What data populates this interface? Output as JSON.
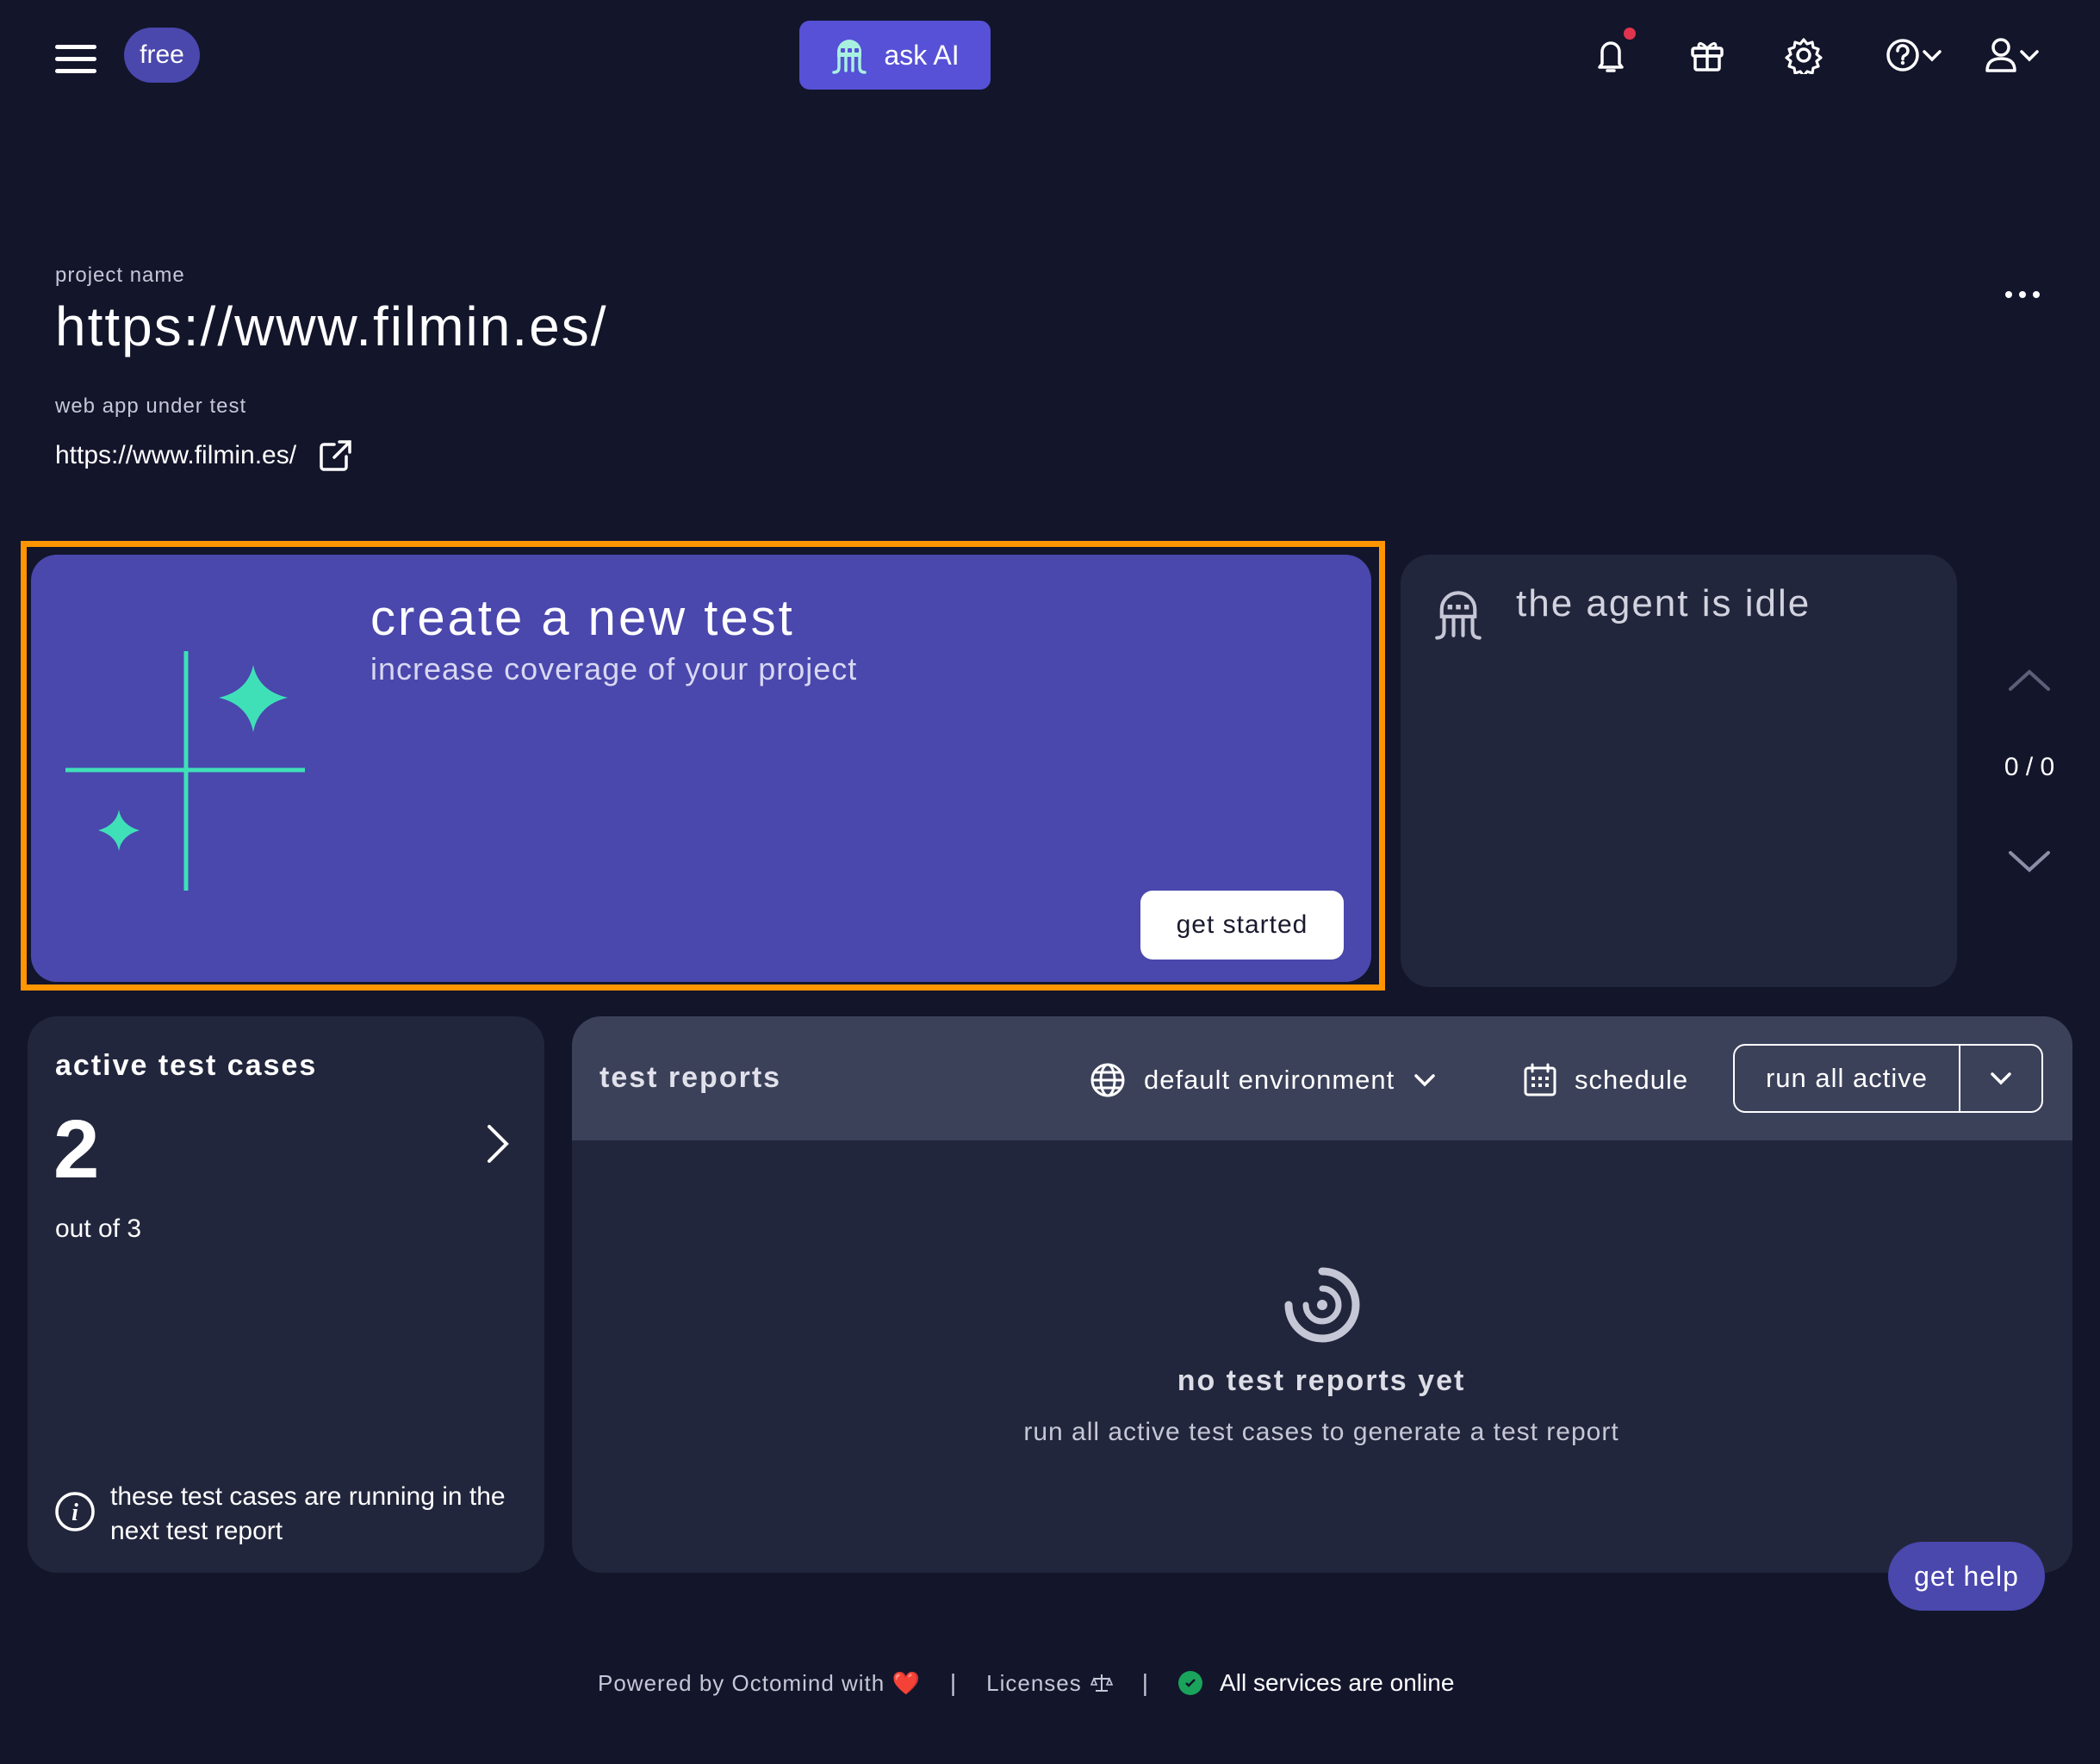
{
  "topbar": {
    "plan_badge": "free",
    "ask_ai_label": "ask AI",
    "icons": [
      "menu-icon",
      "octopus-icon",
      "bell-icon",
      "gift-icon",
      "gear-icon",
      "help-icon",
      "user-icon"
    ]
  },
  "project": {
    "name_label": "project name",
    "name": "https://www.filmin.es/",
    "webapp_label": "web app under test",
    "webapp_url": "https://www.filmin.es/"
  },
  "create_card": {
    "title": "create a new test",
    "subtitle": "increase coverage of your project",
    "button": "get started",
    "accent_color": "#3fe0b8"
  },
  "agent": {
    "status": "the agent is idle",
    "counter": "0 / 0"
  },
  "active_cases": {
    "title": "active test cases",
    "count": "2",
    "out_of": "out of 3",
    "note": "these test cases are running in the next test report"
  },
  "reports": {
    "title": "test reports",
    "environment": "default environment",
    "schedule": "schedule",
    "run_all": "run all active",
    "empty_title": "no test reports yet",
    "empty_sub": "run all active test cases to generate a test report"
  },
  "help_button": "get help",
  "footer": {
    "powered": "Powered by Octomind with",
    "heart": "❤️",
    "sep1": "|",
    "licenses": "Licenses",
    "sep2": "|",
    "status": "All services are online"
  },
  "colors": {
    "background": "#13152b",
    "card": "#22263c",
    "primary": "#4a47ad",
    "ask_ai": "#5651d6",
    "highlight": "#ff9500",
    "online": "#1aa35a"
  }
}
